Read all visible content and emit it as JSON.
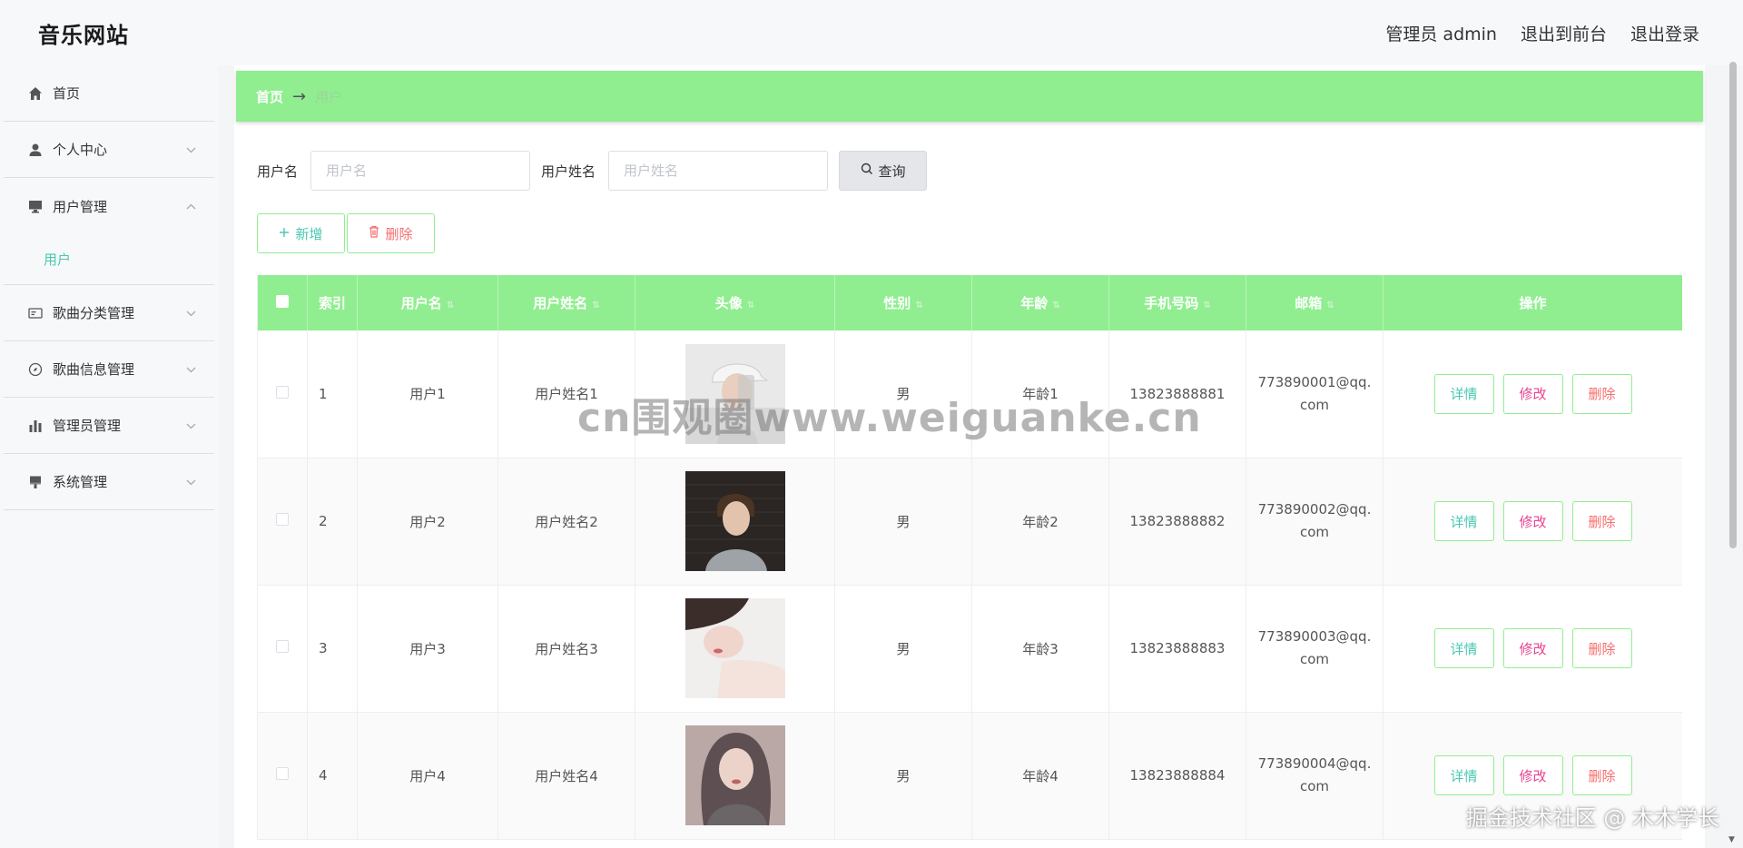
{
  "header": {
    "site_title": "音乐网站",
    "admin_label": "管理员 admin",
    "to_front": "退出到前台",
    "logout": "退出登录"
  },
  "sidebar": {
    "items": [
      {
        "label": "首页",
        "icon": "home-icon"
      },
      {
        "label": "个人中心",
        "icon": "user-icon"
      },
      {
        "label": "用户管理",
        "icon": "monitor-icon"
      },
      {
        "label": "歌曲分类管理",
        "icon": "card-icon"
      },
      {
        "label": "歌曲信息管理",
        "icon": "compass-icon"
      },
      {
        "label": "管理员管理",
        "icon": "bar-chart-icon"
      },
      {
        "label": "系统管理",
        "icon": "brush-icon"
      }
    ],
    "sub_item": "用户"
  },
  "breadcrumb": {
    "home": "首页",
    "arrow": "→",
    "current": "用户"
  },
  "search": {
    "username_label": "用户名",
    "username_placeholder": "用户名",
    "realname_label": "用户姓名",
    "realname_placeholder": "用户姓名",
    "query_label": "查询"
  },
  "actions": {
    "add_label": "新增",
    "delete_label": "删除"
  },
  "table": {
    "headers": [
      "索引",
      "用户名",
      "用户姓名",
      "头像",
      "性别",
      "年龄",
      "手机号码",
      "邮箱",
      "操作"
    ],
    "rows": [
      {
        "index": "1",
        "username": "用户1",
        "realname": "用户姓名1",
        "gender": "男",
        "age": "年龄1",
        "phone": "13823888881",
        "email_1": "773890001@qq.",
        "email_2": "com"
      },
      {
        "index": "2",
        "username": "用户2",
        "realname": "用户姓名2",
        "gender": "男",
        "age": "年龄2",
        "phone": "13823888882",
        "email_1": "773890002@qq.",
        "email_2": "com"
      },
      {
        "index": "3",
        "username": "用户3",
        "realname": "用户姓名3",
        "gender": "男",
        "age": "年龄3",
        "phone": "13823888883",
        "email_1": "773890003@qq.",
        "email_2": "com"
      },
      {
        "index": "4",
        "username": "用户4",
        "realname": "用户姓名4",
        "gender": "男",
        "age": "年龄4",
        "phone": "13823888884",
        "email_1": "773890004@qq.",
        "email_2": "com"
      }
    ],
    "ops": {
      "detail": "详情",
      "edit": "修改",
      "delete": "删除"
    }
  },
  "watermarks": {
    "center": "cn围观圈www.weiguanke.cn",
    "corner": "掘金技术社区 @ 木木学长"
  },
  "colors": {
    "accent_green": "#90ee90",
    "teal": "#48c9b0",
    "danger": "#f56c6c",
    "edit_pink": "#e84393"
  }
}
